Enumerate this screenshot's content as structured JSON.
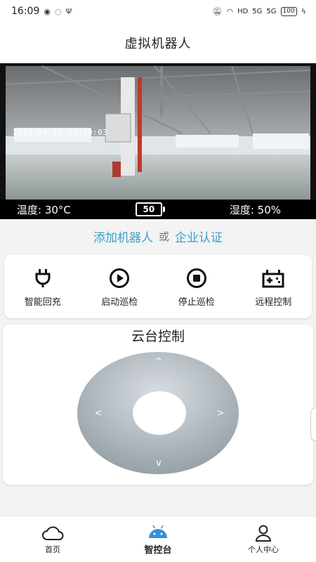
{
  "status_bar": {
    "time": "16:09",
    "network_label": "HD",
    "signal_label": "5G",
    "battery": "100"
  },
  "header": {
    "title": "虚拟机器人"
  },
  "camera": {
    "timestamp": "2025-06-23 10:30:03",
    "temperature": "温度: 30°C",
    "battery_level": "50",
    "humidity": "湿度: 50%"
  },
  "links": {
    "add_robot": "添加机器人",
    "or": "或",
    "enterprise_cert": "企业认证"
  },
  "actions": [
    {
      "label": "智能回充",
      "icon": "plug-icon"
    },
    {
      "label": "启动巡检",
      "icon": "play-circle-icon"
    },
    {
      "label": "停止巡检",
      "icon": "stop-circle-icon"
    },
    {
      "label": "远程控制",
      "icon": "gamepad-icon"
    }
  ],
  "ptz": {
    "title": "云台控制",
    "up": "^",
    "down": "v",
    "left": "<",
    "right": ">"
  },
  "bottom_nav": [
    {
      "label": "首页",
      "icon": "cloud-icon",
      "active": false
    },
    {
      "label": "智控台",
      "icon": "android-icon",
      "active": true
    },
    {
      "label": "个人中心",
      "icon": "person-icon",
      "active": false
    }
  ],
  "colors": {
    "accent": "#3aa0c8",
    "nav_active": "#3b8fd9"
  }
}
